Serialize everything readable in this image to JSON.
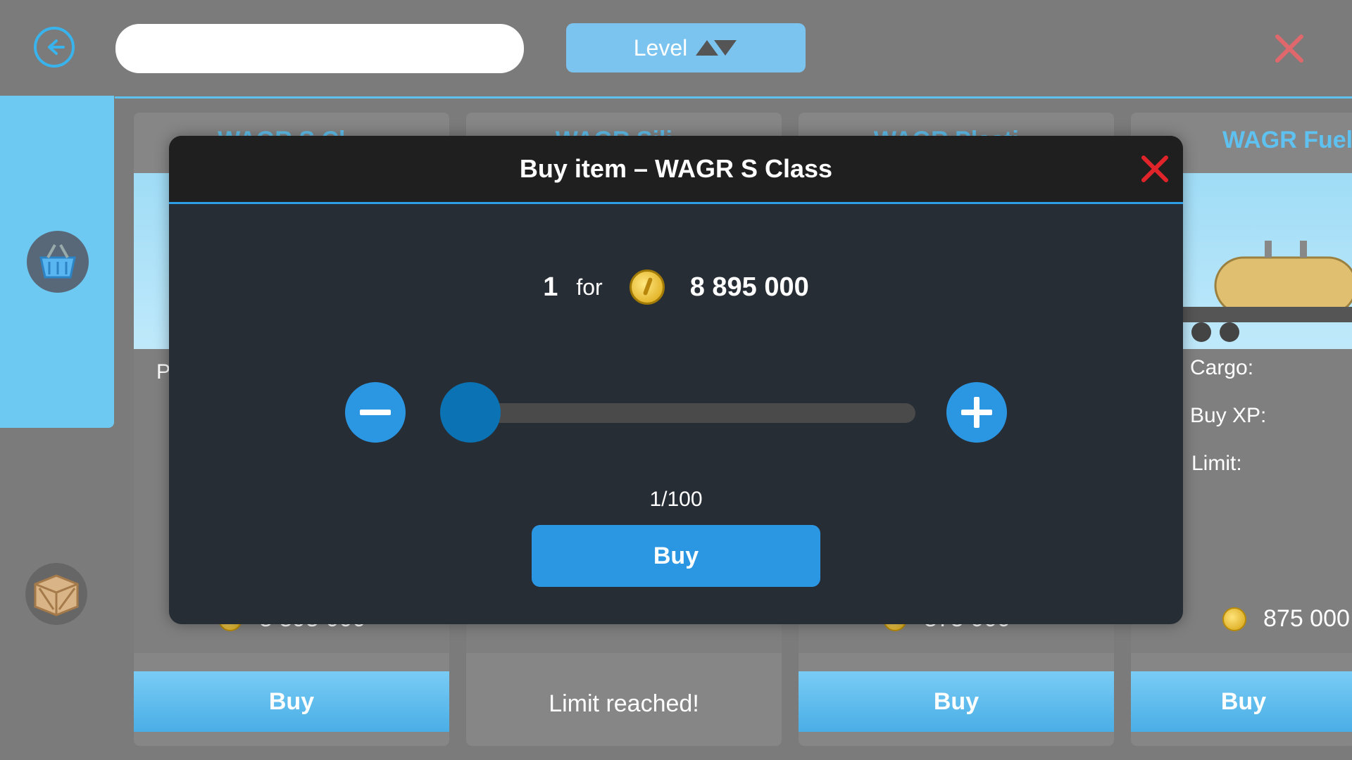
{
  "topbar": {
    "search_placeholder": "",
    "level_label": "Level"
  },
  "cards": [
    {
      "title": "WAGR S Cl...",
      "label_partial": "P",
      "price": "8 895 000",
      "button": "Buy"
    },
    {
      "title": "WAGR Sili...",
      "footer": "Limit reached!"
    },
    {
      "title": "WAGR Plasti...",
      "price": "875 000",
      "button": "Buy"
    },
    {
      "title": "WAGR Fuel",
      "cargo_label": "Cargo:",
      "buy_xp_label": "Buy XP:",
      "limit_label": "Limit:",
      "price": "875 000",
      "button": "Buy"
    }
  ],
  "modal": {
    "title": "Buy item  –  WAGR S Class",
    "quantity": "1",
    "for_label": "for",
    "price": "8 895 000",
    "count_text": "1/100",
    "buy_label": "Buy",
    "slider_value_fraction": 0.01
  },
  "colors": {
    "accent_blue": "#2b97e3",
    "sky_blue": "#6ec9f2",
    "close_red": "#e0242a"
  }
}
